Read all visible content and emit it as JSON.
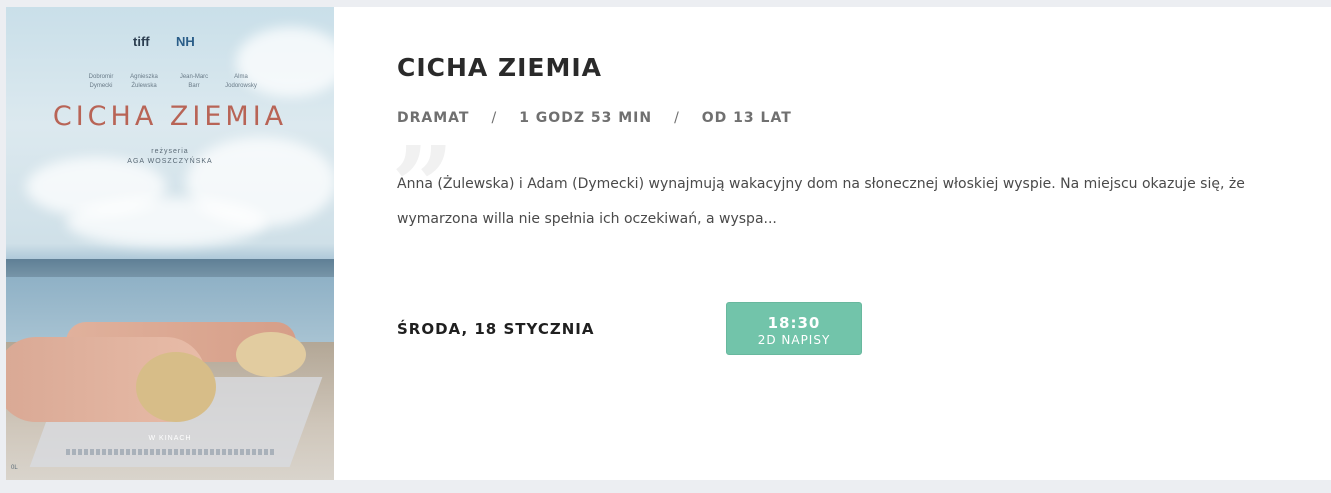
{
  "poster": {
    "logo_left": "tiff",
    "logo_right": "NH",
    "cast": [
      {
        "first": "Dobromir",
        "last": "Dymecki"
      },
      {
        "first": "Agnieszka",
        "last": "Żulewska"
      },
      {
        "first": "Jean-Marc",
        "last": "Barr"
      },
      {
        "first": "Alma",
        "last": "Jodorowsky"
      }
    ],
    "title": "CICHA ZIEMIA",
    "director_label": "reżyseria",
    "director_name": "AGA WOSZCZYŃSKA",
    "release": "W KINACH",
    "age_badge": "0L"
  },
  "movie": {
    "title": "CICHA ZIEMIA",
    "genre": "DRAMAT",
    "duration": "1 GODZ 53 MIN",
    "age": "OD 13 LAT",
    "separator": "/",
    "quote_mark": "”",
    "description": "Anna (Żulewska) i Adam (Dymecki) wynajmują wakacyjny dom na słonecznej włoskiej wyspie. Na miejscu okazuje się, że wymarzona willa nie spełnia ich oczekiwań, a wyspa..."
  },
  "showtimes": {
    "date": "ŚRODA, 18 STYCZNIA",
    "sessions": [
      {
        "time": "18:30",
        "format": "2D NAPISY"
      }
    ]
  },
  "colors": {
    "button": "#72c4aa",
    "poster_title": "#b86456",
    "page_bg": "#eceef2"
  }
}
